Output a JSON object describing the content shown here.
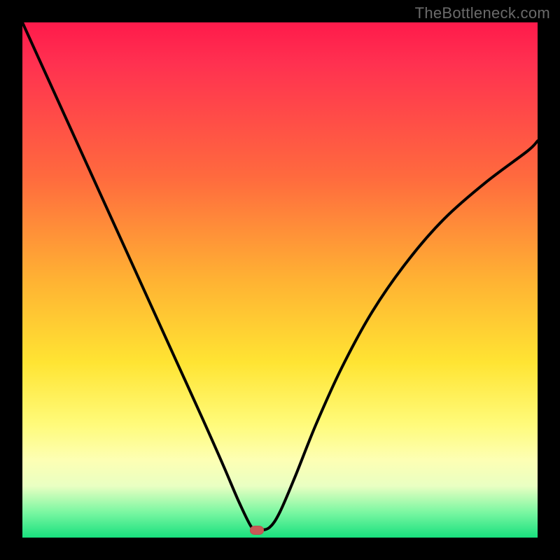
{
  "watermark": "TheBottleneck.com",
  "marker": {
    "x_pct": 45.5,
    "y_pct": 98.5
  },
  "colors": {
    "curve": "#000000",
    "marker": "#c85a56",
    "frame": "#000000"
  },
  "chart_data": {
    "type": "line",
    "title": "",
    "xlabel": "",
    "ylabel": "",
    "x_range_pct": [
      0,
      100
    ],
    "y_range_pct": [
      0,
      100
    ],
    "note": "Axes are unlabeled in the image; x/y expressed as percent of plot width/height (0,0 at top-left of colored area, y increases downward).",
    "series": [
      {
        "name": "curve",
        "x": [
          0,
          5,
          10,
          15,
          20,
          25,
          30,
          35,
          39,
          42,
          44.5,
          46,
          48,
          50,
          53,
          57,
          62,
          68,
          75,
          82,
          90,
          98,
          100
        ],
        "y": [
          0,
          11,
          22,
          33,
          44,
          55,
          66,
          77,
          86,
          93,
          98,
          98.5,
          98,
          95,
          88,
          78,
          67,
          56,
          46,
          38,
          31,
          25,
          23
        ]
      }
    ],
    "marker_point": {
      "x": 45.5,
      "y": 98.5
    }
  }
}
